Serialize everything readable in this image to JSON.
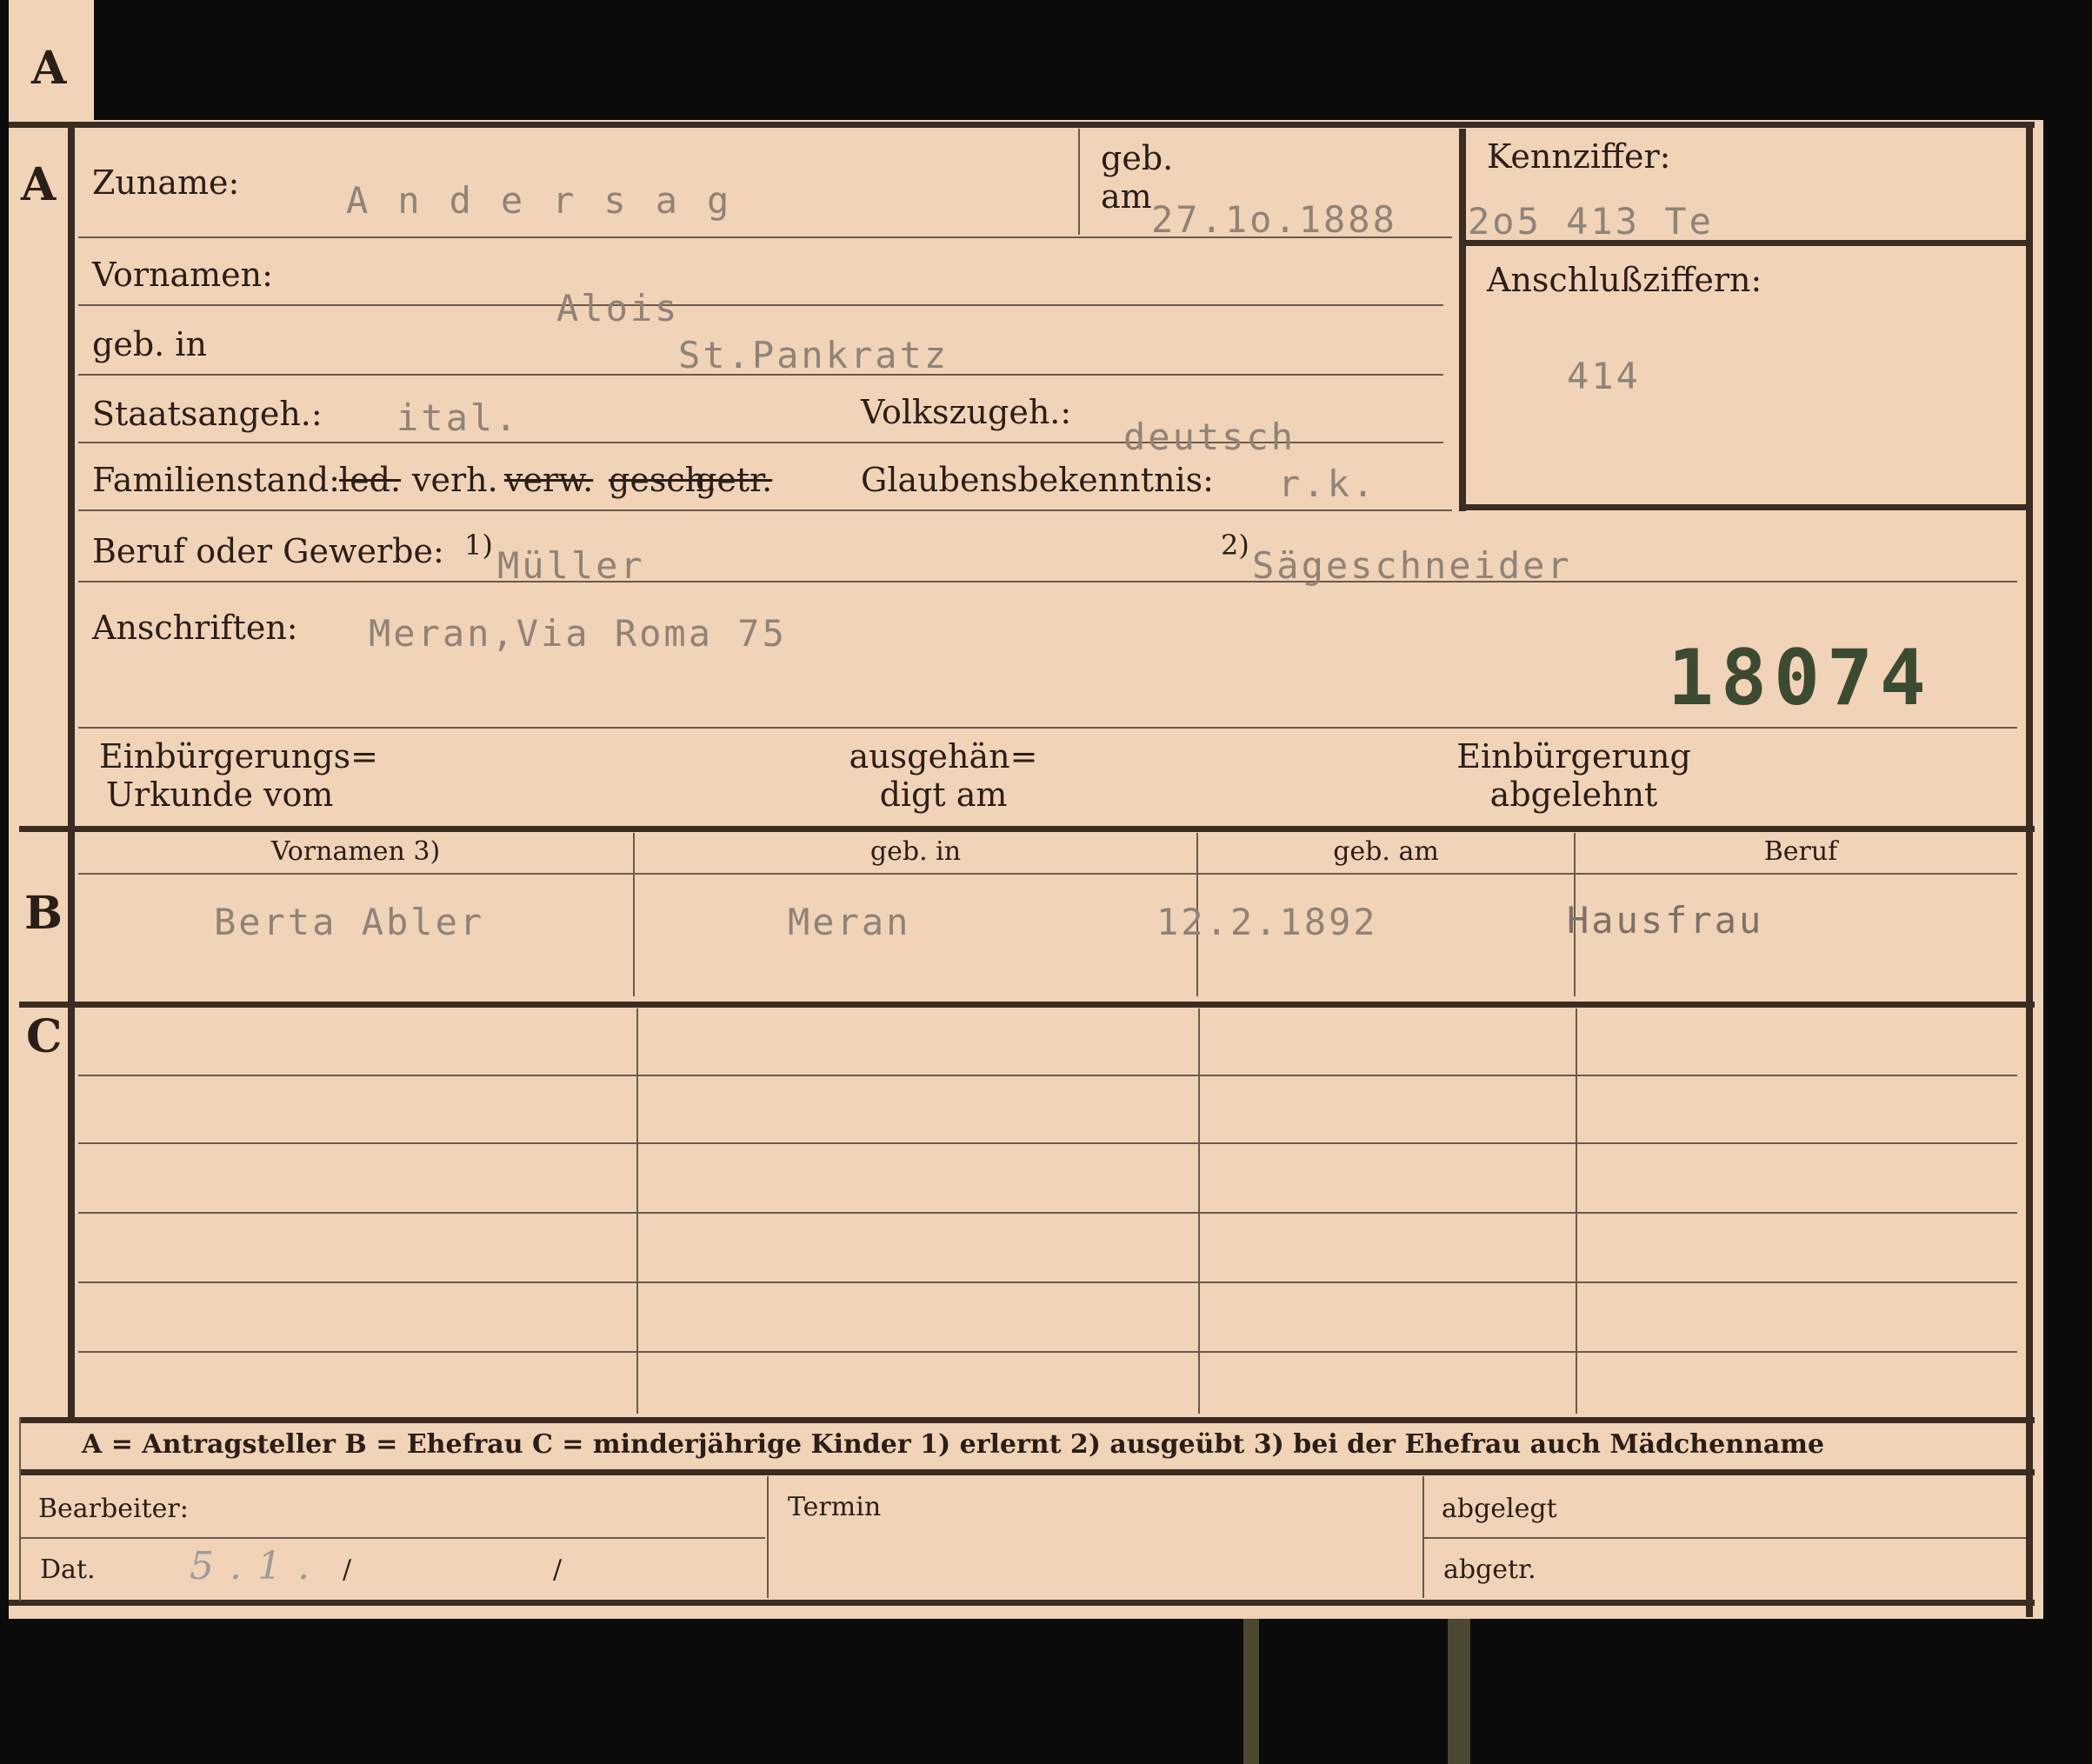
{
  "section_marks": {
    "tab": "A",
    "a": "A",
    "b": "B",
    "c": "C"
  },
  "header": {
    "zuname_label": "Zuname:",
    "zuname_value": "Andersag",
    "geb_label_1": "geb.",
    "geb_label_2": "am",
    "geb_value": "27.1o.1888",
    "kennziffer_label": "Kennziffer:",
    "kennziffer_value": "2o5 413 Te",
    "anschluss_label": "Anschlußziffern:",
    "anschluss_value": "414"
  },
  "person": {
    "vornamen_label": "Vornamen:",
    "vornamen_value": "Alois",
    "gebin_label": "geb. in",
    "gebin_value": "St.Pankratz",
    "staat_label": "Staatsangeh.:",
    "staat_value": "ital.",
    "volk_label": "Volkszugeh.:",
    "volk_value": "deutsch",
    "familien_label": "Familienstand:",
    "familien_options": [
      "led.",
      "verh.",
      "verw.",
      "gesch.",
      "getr."
    ],
    "glauben_label": "Glaubensbekenntnis:",
    "glauben_value": "r.k.",
    "beruf_label": "Beruf oder Gewerbe:",
    "beruf_mark1": "1)",
    "beruf_value1": "Müller",
    "beruf_mark2": "2)",
    "beruf_value2": "Sägeschneider",
    "anschrift_label": "Anschriften:",
    "anschrift_value": "Meran,Via Roma 75",
    "stamp_number": "18074"
  },
  "naturalization": {
    "col1_line1": "Einbürgerungs=",
    "col1_line2": "Urkunde vom",
    "col2_line1": "ausgehän=",
    "col2_line2": "digt am",
    "col3_line1": "Einbürgerung",
    "col3_line2": "abgelehnt"
  },
  "spouse_table": {
    "headers": [
      "Vornamen 3)",
      "geb. in",
      "geb. am",
      "Beruf"
    ],
    "row": [
      "Berta Abler",
      "Meran",
      "12.2.1892",
      "Hausfrau"
    ]
  },
  "legend": "A = Antragsteller   B = Ehefrau   C = minderjährige Kinder   1) erlernt   2) ausgeübt   3) bei der Ehefrau auch Mädchenname",
  "footer": {
    "bearbeiter_label": "Bearbeiter:",
    "termin_label": "Termin",
    "abgelegt_label": "abgelegt",
    "dat_label": "Dat.",
    "dat_value": "5.1.",
    "slash1": "/",
    "slash2": "/",
    "abgetr_label": "abgetr."
  }
}
